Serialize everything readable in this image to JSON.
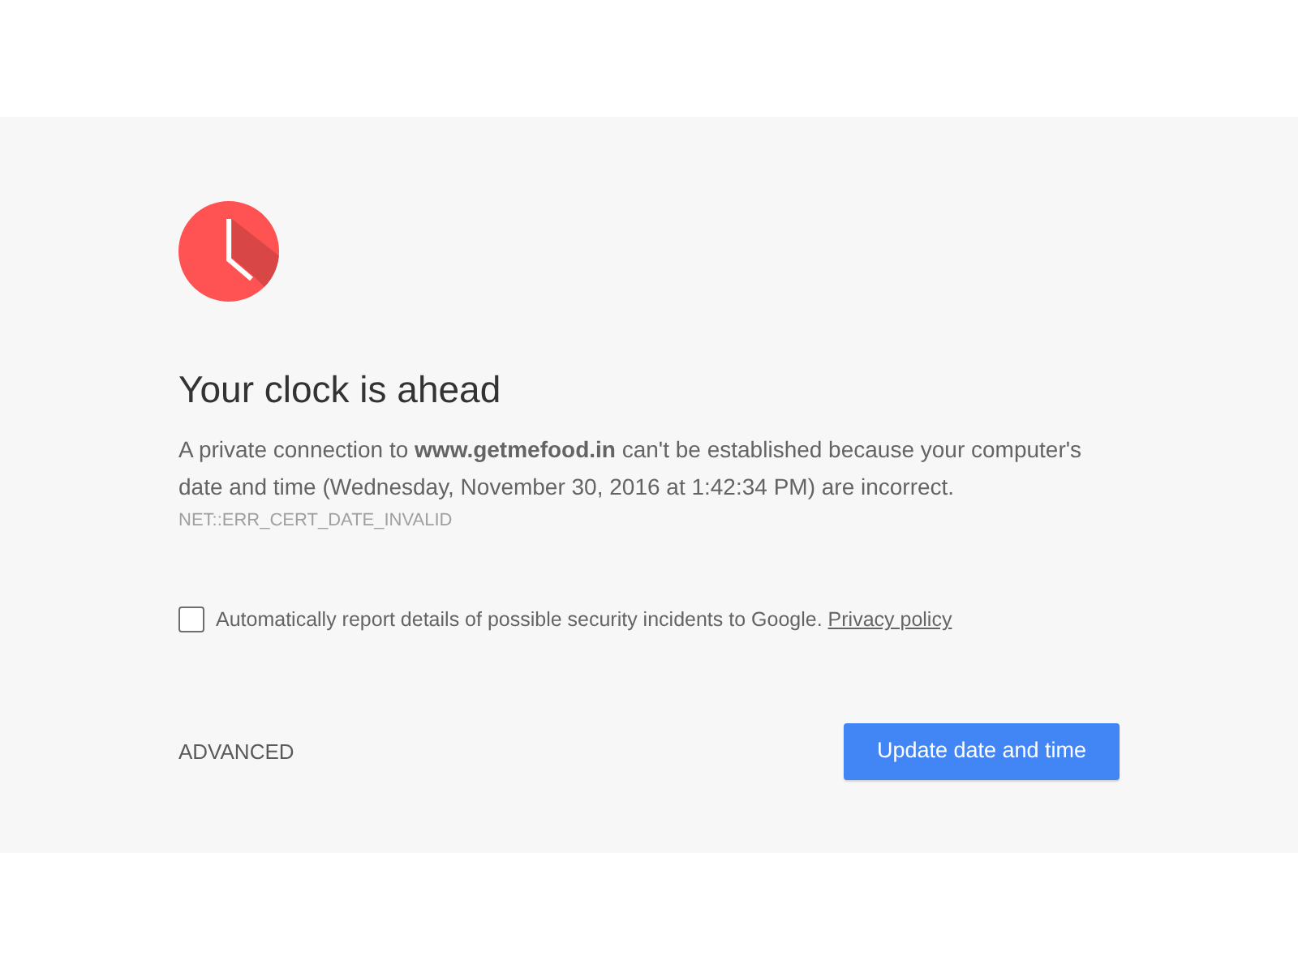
{
  "interstitial": {
    "title": "Your clock is ahead",
    "message": "A private connection to **www.getmefood.in** can't be established because your computer's date and time (Wednesday, November 30, 2016 at 1:42:34 PM) are incorrect.",
    "error_code": "NET::ERR_CERT_DATE_INVALID",
    "report_option": {
      "label": "Automatically report details of possible security incidents to Google.",
      "link": "Privacy policy",
      "checked": false
    },
    "buttons": [
      {
        "kind": "link",
        "label": "ADVANCED"
      },
      {
        "kind": "primary",
        "label": "Update date and time"
      }
    ]
  }
}
